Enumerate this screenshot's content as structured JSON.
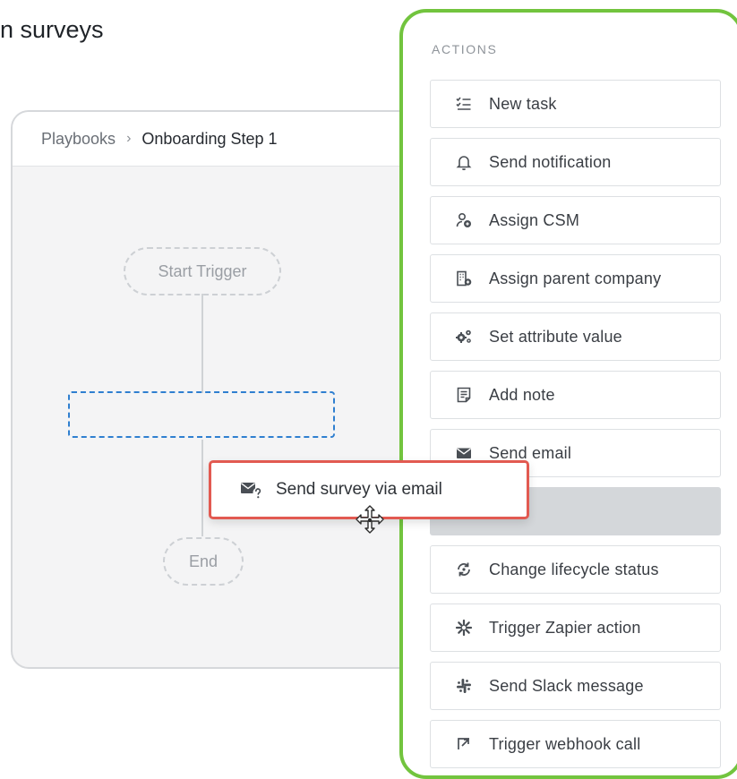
{
  "heading": "n surveys",
  "breadcrumb": {
    "root": "Playbooks",
    "separator": "›",
    "current": "Onboarding Step 1"
  },
  "flow": {
    "start": "Start Trigger",
    "end": "End"
  },
  "panel": {
    "title": "ACTIONS",
    "items": [
      {
        "label": "New task",
        "icon": "task-list-icon"
      },
      {
        "label": "Send notification",
        "icon": "bell-icon"
      },
      {
        "label": "Assign CSM",
        "icon": "assign-user-icon"
      },
      {
        "label": "Assign parent company",
        "icon": "building-icon"
      },
      {
        "label": "Set attribute value",
        "icon": "gears-icon"
      },
      {
        "label": "Add note",
        "icon": "note-icon"
      },
      {
        "label": "Send email",
        "icon": "envelope-icon"
      },
      {
        "label": "Change lifecycle status",
        "icon": "cycle-icon"
      },
      {
        "label": "Trigger Zapier action",
        "icon": "zapier-icon"
      },
      {
        "label": "Send Slack message",
        "icon": "slack-icon"
      },
      {
        "label": "Trigger webhook call",
        "icon": "webhook-icon"
      }
    ]
  },
  "dragged": {
    "label": "Send survey via email",
    "icon": "survey-email-icon"
  },
  "colors": {
    "panel_border": "#72c43e",
    "drag_border": "#e25a51",
    "drop_zone": "#2f7fd0"
  }
}
